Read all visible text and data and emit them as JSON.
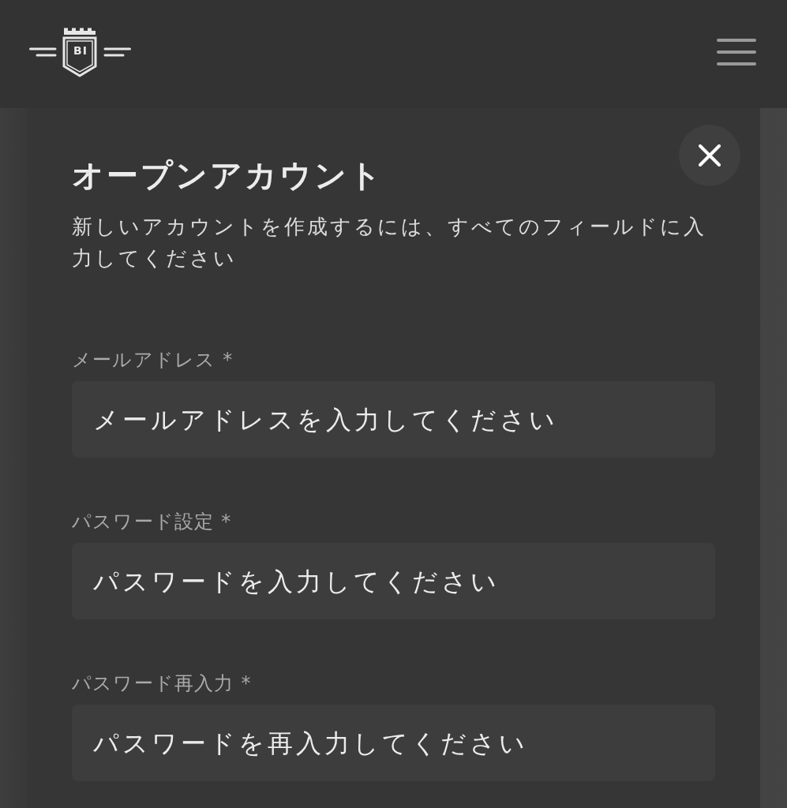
{
  "header": {
    "logo": {
      "text": "BI"
    }
  },
  "modal": {
    "title": "オープンアカウント",
    "subtitle": "新しいアカウントを作成するには、すべてのフィールドに入力してください",
    "fields": [
      {
        "label": "メールアドレス *",
        "placeholder": "メールアドレスを入力してください"
      },
      {
        "label": "パスワード設定 *",
        "placeholder": "パスワードを入力してください"
      },
      {
        "label": "パスワード再入力 *",
        "placeholder": "パスワードを再入力してください"
      }
    ]
  }
}
